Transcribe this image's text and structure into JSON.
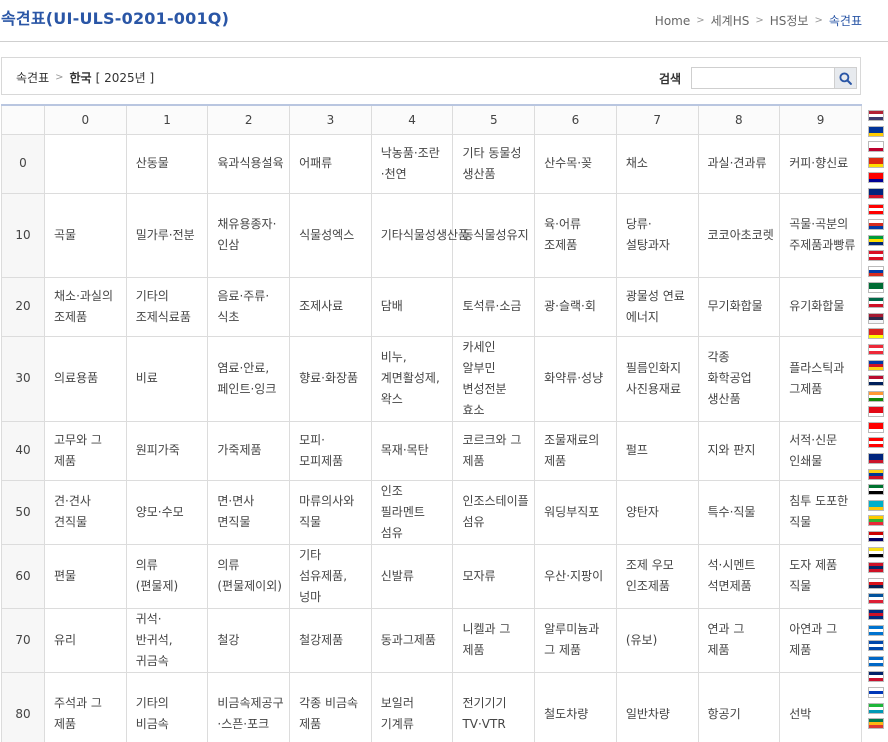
{
  "header": {
    "title": "속견표(UI-ULS-0201-001Q)",
    "breadcrumb": [
      "Home",
      "세계HS",
      "HS정보",
      "속견표"
    ]
  },
  "filter": {
    "root": "속견표",
    "country": "한국",
    "year": "[ 2025년 ]",
    "search_label": "검색",
    "search_value": "",
    "search_icon": "search-icon"
  },
  "table": {
    "columns": [
      "0",
      "1",
      "2",
      "3",
      "4",
      "5",
      "6",
      "7",
      "8",
      "9"
    ],
    "rows": [
      {
        "head": "0",
        "cells": [
          "",
          "산동물",
          "육과식용설육",
          "어패류",
          "낙농품·조란·천연",
          "기타 동물성 생산품",
          "산수목·꽂",
          "채소",
          "과실·견과류",
          "커피·향신료"
        ]
      },
      {
        "head": "10",
        "cells": [
          "곡물",
          "밀가루·전분",
          "채유용종자·인삼",
          "식물성엑스",
          "기타식물성생산품",
          "동식물성유지",
          "육·어류 조제품",
          "당류·설탕과자",
          "코코아초코렛",
          "곡물·곡분의 주제품과빵류"
        ]
      },
      {
        "head": "20",
        "cells": [
          "채소·과실의 조제품",
          "기타의 조제식료품",
          "음료·주류·식초",
          "조제사료",
          "담배",
          "토석류·소금",
          "광·슬랙·회",
          "광물성 연료 에너지",
          "무기화합물",
          "유기화합물"
        ]
      },
      {
        "head": "30",
        "cells": [
          "의료용품",
          "비료",
          "염료·안료, 페인트·잉크",
          "향료·화장품",
          "비누, 계면활성제, 왁스",
          "카세인 알부민 변성전분 효소",
          "화약류·성냥",
          "필름인화지 사진용재료",
          "각종 화학공업 생산품",
          "플라스틱과 그제품"
        ]
      },
      {
        "head": "40",
        "cells": [
          "고무와 그 제품",
          "원피가죽",
          "가죽제품",
          "모피·모피제품",
          "목재·목탄",
          "코르크와 그 제품",
          "조물재료의 제품",
          "펄프",
          "지와 판지",
          "서적·신문 인쇄물"
        ]
      },
      {
        "head": "50",
        "cells": [
          "견·견사 견직물",
          "양모·수모",
          "면·면사 면직물",
          "마류의사와 직물",
          "인조 필라멘트 섬유",
          "인조스테이플 섬유",
          "워딩부직포",
          "양탄자",
          "특수·직물",
          "침투 도포한 직물"
        ]
      },
      {
        "head": "60",
        "cells": [
          "편물",
          "의류(편물제)",
          "의류(편물제이외)",
          "기타 섬유제품,넝마",
          "신발류",
          "모자류",
          "우산·지팡이",
          "조제 우모 인조제품",
          "석·시멘트 석면제품",
          "도자 제품 직물"
        ]
      },
      {
        "head": "70",
        "cells": [
          "유리",
          "귀석·반귀석,귀금속",
          "철강",
          "철강제품",
          "동과그제품",
          "니켈과 그 제품",
          "알루미늄과 그 제품",
          "(유보)",
          "연과 그 제품",
          "아연과 그 제품"
        ]
      },
      {
        "head": "80",
        "cells": [
          "주석과 그 제품",
          "기타의 비금속",
          "비금속제공구·스픈·포크",
          "각종 비금속 제품",
          "보일러 기계류",
          "전기기기 TV·VTR",
          "철도차량",
          "일반차량",
          "항공기",
          "선박"
        ]
      }
    ]
  },
  "flags": [
    {
      "name": "usa",
      "colors": [
        "#b22234",
        "#ffffff",
        "#3c3b6e"
      ]
    },
    {
      "name": "eu",
      "colors": [
        "#003399",
        "#003399",
        "#ffcc00"
      ]
    },
    {
      "name": "japan",
      "colors": [
        "#ffffff",
        "#ffffff",
        "#bc002d"
      ]
    },
    {
      "name": "china",
      "colors": [
        "#de2910",
        "#de2910",
        "#ffde00"
      ]
    },
    {
      "name": "taiwan",
      "colors": [
        "#fe0000",
        "#fe0000",
        "#000095"
      ]
    },
    {
      "name": "australia",
      "colors": [
        "#00247d",
        "#00247d",
        "#cf142b"
      ]
    },
    {
      "name": "canada",
      "colors": [
        "#ff0000",
        "#ffffff",
        "#ff0000"
      ]
    },
    {
      "name": "chile",
      "colors": [
        "#ffffff",
        "#d52b1e",
        "#0039a6"
      ]
    },
    {
      "name": "brazil",
      "colors": [
        "#009c3b",
        "#ffdf00",
        "#002776"
      ]
    },
    {
      "name": "peru",
      "colors": [
        "#d91023",
        "#ffffff",
        "#d91023"
      ]
    },
    {
      "name": "russia",
      "colors": [
        "#ffffff",
        "#0039a6",
        "#d52b1e"
      ]
    },
    {
      "name": "saudi-arabia",
      "colors": [
        "#006c35",
        "#006c35",
        "#ffffff"
      ]
    },
    {
      "name": "mexico",
      "colors": [
        "#006847",
        "#ffffff",
        "#ce1126"
      ]
    },
    {
      "name": "thailand",
      "colors": [
        "#a51931",
        "#2d2a4a",
        "#f4f5f8"
      ]
    },
    {
      "name": "vietnam",
      "colors": [
        "#da251d",
        "#da251d",
        "#ffff00"
      ]
    },
    {
      "name": "singapore",
      "colors": [
        "#ed2939",
        "#ffffff",
        "#ed2939"
      ]
    },
    {
      "name": "philippines",
      "colors": [
        "#0038a8",
        "#ce1126",
        "#fcd116"
      ]
    },
    {
      "name": "norway",
      "colors": [
        "#ba0c2f",
        "#ffffff",
        "#00205b"
      ]
    },
    {
      "name": "india",
      "colors": [
        "#ff9933",
        "#ffffff",
        "#138808"
      ]
    },
    {
      "name": "turkey",
      "colors": [
        "#e30a17",
        "#e30a17",
        "#ffffff"
      ]
    },
    {
      "name": "switzerland",
      "colors": [
        "#ff0000",
        "#ff0000",
        "#ffffff"
      ]
    },
    {
      "name": "canada-2",
      "colors": [
        "#ff0000",
        "#ffffff",
        "#ff0000"
      ]
    },
    {
      "name": "new-zealand",
      "colors": [
        "#00247d",
        "#00247d",
        "#cc142b"
      ]
    },
    {
      "name": "colombia",
      "colors": [
        "#fcd116",
        "#003893",
        "#ce1126"
      ]
    },
    {
      "name": "uae",
      "colors": [
        "#00732f",
        "#ffffff",
        "#000000"
      ]
    },
    {
      "name": "kazakhstan",
      "colors": [
        "#00afca",
        "#00afca",
        "#fec50c"
      ]
    },
    {
      "name": "myanmar",
      "colors": [
        "#fecb00",
        "#34b233",
        "#ea2839"
      ]
    },
    {
      "name": "malaysia",
      "colors": [
        "#cc0001",
        "#ffffff",
        "#010066"
      ]
    },
    {
      "name": "brunei",
      "colors": [
        "#f7e017",
        "#ffffff",
        "#000000"
      ]
    },
    {
      "name": "laos",
      "colors": [
        "#ce1126",
        "#002868",
        "#ce1126"
      ]
    },
    {
      "name": "panama",
      "colors": [
        "#ffffff",
        "#da121a",
        "#072357"
      ]
    },
    {
      "name": "iceland",
      "colors": [
        "#02529c",
        "#ffffff",
        "#dc1e35"
      ]
    },
    {
      "name": "costa-rica",
      "colors": [
        "#002b7f",
        "#ce1126",
        "#002b7f"
      ]
    },
    {
      "name": "honduras",
      "colors": [
        "#0073cf",
        "#ffffff",
        "#0073cf"
      ]
    },
    {
      "name": "el-salvador",
      "colors": [
        "#0047ab",
        "#ffffff",
        "#0047ab"
      ]
    },
    {
      "name": "nicaragua",
      "colors": [
        "#0067c6",
        "#ffffff",
        "#0067c6"
      ]
    },
    {
      "name": "uk",
      "colors": [
        "#012169",
        "#ffffff",
        "#c8102e"
      ]
    },
    {
      "name": "israel",
      "colors": [
        "#ffffff",
        "#0038b8",
        "#ffffff"
      ]
    },
    {
      "name": "uzbekistan",
      "colors": [
        "#1eb53a",
        "#ffffff",
        "#0099b5"
      ]
    },
    {
      "name": "south-africa",
      "colors": [
        "#007a4d",
        "#ffb612",
        "#de3831"
      ]
    }
  ]
}
